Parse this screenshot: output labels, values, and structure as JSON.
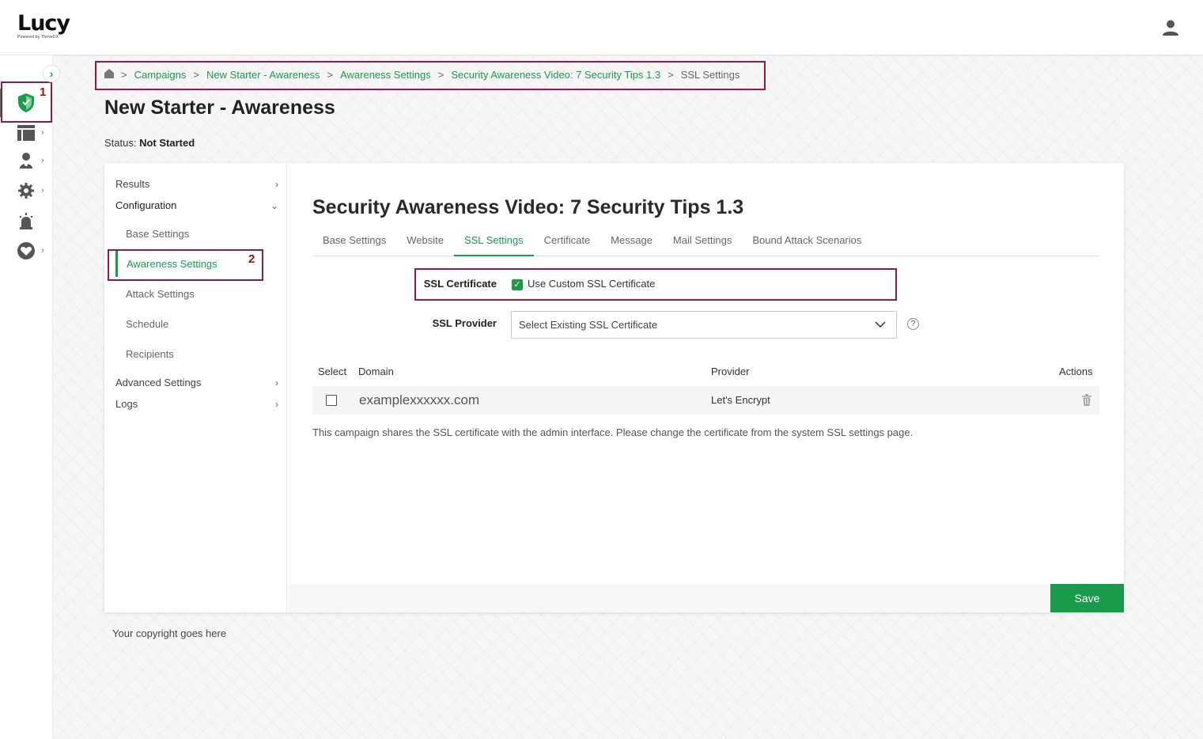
{
  "app": {
    "logo_text": "Lucy",
    "logo_subtext": "Powered by ThriveDX"
  },
  "breadcrumb": {
    "items": [
      "Campaigns",
      "New Starter - Awareness",
      "Awareness Settings",
      "Security Awareness Video: 7 Security Tips 1.3"
    ],
    "current": "SSL Settings",
    "separator": ">"
  },
  "page": {
    "title": "New Starter - Awareness",
    "status_label": "Status:",
    "status_value": "Not Started"
  },
  "side_nav": {
    "results": "Results",
    "configuration": "Configuration",
    "sub_items": [
      "Base Settings",
      "Awareness Settings",
      "Attack Settings",
      "Schedule",
      "Recipients"
    ],
    "advanced": "Advanced Settings",
    "logs": "Logs"
  },
  "content": {
    "title": "Security Awareness Video: 7 Security Tips 1.3",
    "tabs": [
      "Base Settings",
      "Website",
      "SSL Settings",
      "Certificate",
      "Message",
      "Mail Settings",
      "Bound Attack Scenarios"
    ],
    "active_tab": "SSL Settings"
  },
  "form": {
    "ssl_certificate_label": "SSL Certificate",
    "custom_ssl_checkbox_label": "Use Custom SSL Certificate",
    "custom_ssl_checked": true,
    "ssl_provider_label": "SSL Provider",
    "ssl_provider_value": "Select Existing SSL Certificate",
    "help_glyph": "?"
  },
  "table": {
    "headers": [
      "Select",
      "Domain",
      "Provider",
      "Actions"
    ],
    "rows": [
      {
        "domain": "examplexxxxxx.com",
        "provider": "Let's Encrypt",
        "selected": false
      }
    ]
  },
  "note": "This campaign shares the SSL certificate with the admin interface. Please change the certificate from the system SSL settings page.",
  "actions": {
    "save_label": "Save"
  },
  "footer": {
    "copyright": "Your copyright goes here"
  },
  "annotations": {
    "marker_1": "1",
    "marker_2": "2"
  },
  "colors": {
    "accent": "#1a9b4b",
    "annotation_border": "#8c1c4c",
    "annotation_number": "#a01010"
  },
  "icons": {
    "rail": [
      "shield-icon",
      "list-icon",
      "users-icon",
      "gear-icon",
      "alarm-icon",
      "heart-icon"
    ],
    "header": "user-icon"
  }
}
